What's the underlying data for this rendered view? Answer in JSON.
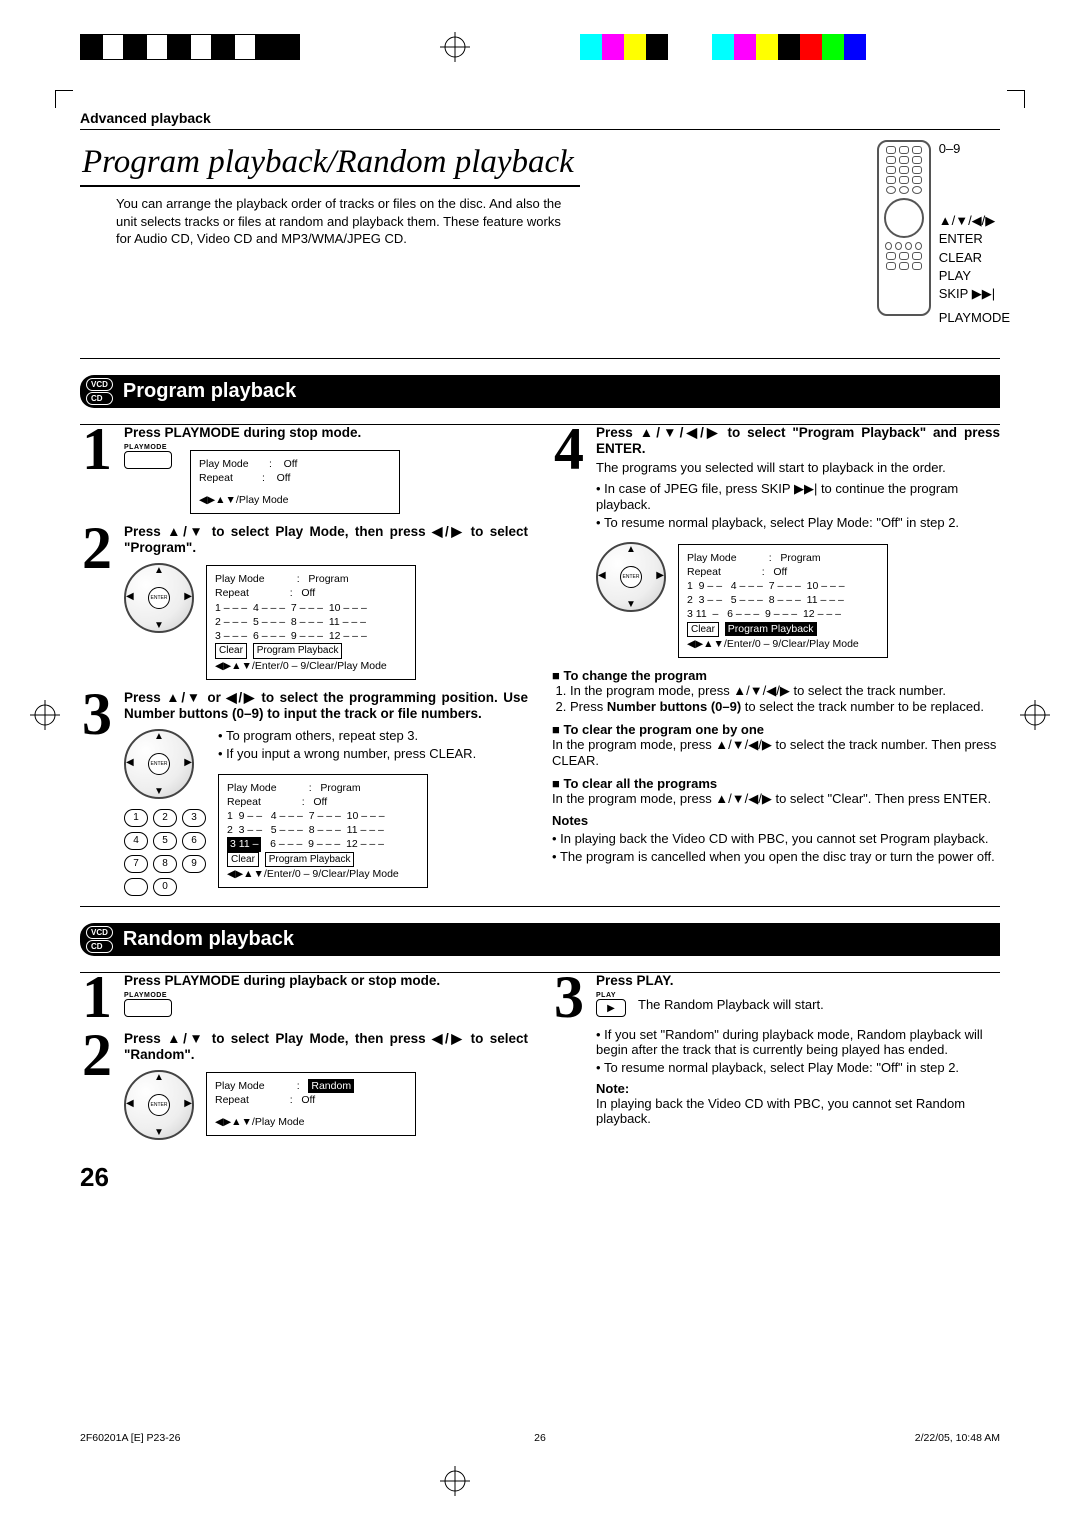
{
  "header": {
    "section": "Advanced playback"
  },
  "title": "Program playback/Random playback",
  "intro": "You can arrange the playback order of tracks or files on the disc. And also the unit selects tracks or files at random and playback them. These feature works for Audio CD, Video CD and MP3/WMA/JPEG CD.",
  "remote": {
    "labels": [
      "0–9",
      "▲/▼/◀/▶",
      "ENTER",
      "CLEAR",
      "PLAY",
      "SKIP ▶▶|",
      "PLAYMODE"
    ]
  },
  "band1": {
    "badges": [
      "VCD",
      "CD"
    ],
    "title": "Program playback"
  },
  "program": {
    "step1": {
      "title": "Press PLAYMODE during stop mode.",
      "playmode_label": "PLAYMODE",
      "osd": {
        "rows": [
          "Play Mode       :    Off",
          "Repeat          :    Off"
        ],
        "hint": "◀▶▲▼/Play Mode"
      }
    },
    "step2": {
      "title": "Press ▲/▼ to select Play Mode, then press ◀/▶ to select \"Program\".",
      "osd": {
        "rows": [
          "Play Mode           :   Program",
          "Repeat              :   Off",
          "1 – – –  4 – – –  7 – – –  10 – – –",
          "2 – – –  5 – – –  8 – – –  11 – – –",
          "3 – – –  6 – – –  9 – – –  12 – – –"
        ],
        "clear": "Clear",
        "pp": "Program Playback",
        "hint": "◀▶▲▼/Enter/0 – 9/Clear/Play Mode"
      }
    },
    "step3": {
      "title": "Press ▲/▼ or ◀/▶ to select the programming position. Use Number buttons (0–9) to input the track or file numbers.",
      "bullets": [
        "To program others, repeat step 3.",
        "If you input a wrong number, press CLEAR."
      ],
      "clear_word": "CLEAR",
      "osd": {
        "rows": [
          "Play Mode           :   Program",
          "Repeat              :   Off",
          "1  9 – –   4 – – –  7 – – –  10 – – –",
          "2  3 – –   5 – – –  8 – – –  11 – – –"
        ],
        "row3hl": "3 11 –",
        "row3rest": "   6 – – –  9 – – –  12 – – –",
        "clear": "Clear",
        "pp": "Program Playback",
        "hint": "◀▶▲▼/Enter/0 – 9/Clear/Play Mode"
      }
    },
    "step4": {
      "title": "Press ▲/▼/◀/▶ to select \"Program Playback\" and press ENTER.",
      "body1": "The programs you selected will start to playback in the order.",
      "bullets": [
        "In case of JPEG file, press SKIP ▶▶| to continue the program playback.",
        "To resume normal playback, select Play Mode: \"Off\" in step 2."
      ],
      "osd": {
        "rows": [
          "Play Mode           :   Program",
          "Repeat              :   Off",
          "1  9 – –   4 – – –  7 – – –  10 – – –",
          "2  3 – –   5 – – –  8 – – –  11 – – –",
          "3 11  –   6 – – –  9 – – –  12 – – –"
        ],
        "clear": "Clear",
        "pp": "Program Playback",
        "hint": "◀▶▲▼/Enter/0 – 9/Clear/Play Mode"
      }
    },
    "sub1": {
      "title": "To change the program",
      "li1": "In the program mode, press ▲/▼/◀/▶ to select the track number.",
      "li2a": "Press ",
      "li2b": "Number buttons (0–9)",
      "li2c": " to select the track number to be replaced."
    },
    "sub2": {
      "title": "To clear the program one by one",
      "text": "In the program mode, press ▲/▼/◀/▶ to select the track number. Then press CLEAR."
    },
    "sub3": {
      "title": "To clear all the programs",
      "text": "In the program mode, press ▲/▼/◀/▶ to select \"Clear\". Then press ENTER."
    },
    "notes": {
      "title": "Notes",
      "items": [
        "In playing back the Video CD with PBC, you cannot set Program playback.",
        "The program is cancelled when you open the disc tray or turn the power off."
      ]
    }
  },
  "band2": {
    "badges": [
      "VCD",
      "CD"
    ],
    "title": "Random playback"
  },
  "random": {
    "step1": {
      "title": "Press PLAYMODE during playback or stop mode.",
      "playmode_label": "PLAYMODE"
    },
    "step2": {
      "title": "Press ▲/▼ to select Play Mode, then press ◀/▶ to select \"Random\".",
      "osd": {
        "row1a": "Play Mode           :   ",
        "row1hl": "Random",
        "row2": "Repeat              :   Off",
        "hint": "◀▶▲▼/Play Mode"
      }
    },
    "step3": {
      "title": "Press PLAY.",
      "play_label": "PLAY",
      "body": "The Random Playback will start.",
      "bullets": [
        "If you set \"Random\" during playback mode, Random playback will begin after the track that is currently being played has ended.",
        "To resume normal playback, select Play Mode: \"Off\" in step 2."
      ]
    },
    "note_title": "Note:",
    "note_body": "In playing back the Video CD with PBC, you cannot set Random playback."
  },
  "page_number": "26",
  "footer": {
    "left": "2F60201A [E] P23-26",
    "mid": "26",
    "right": "2/22/05, 10:48 AM"
  },
  "numpad": [
    "1",
    "2",
    "3",
    "4",
    "5",
    "6",
    "7",
    "8",
    "9",
    "0"
  ],
  "enter_label": "ENTER"
}
